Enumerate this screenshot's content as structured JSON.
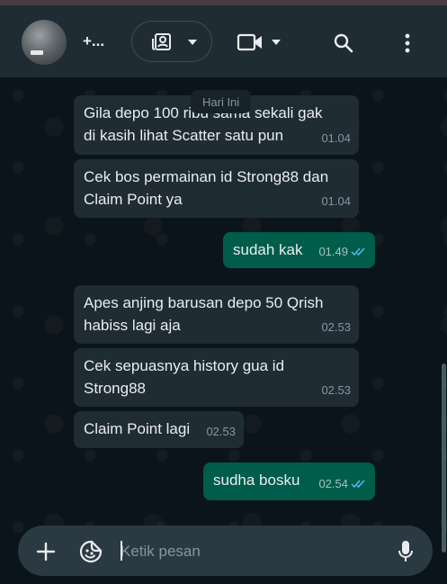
{
  "header": {
    "contact_name": "+...",
    "avatar_label": "",
    "icons": {
      "contacts": "contact-book-icon",
      "dropdown": "chevron-down-icon",
      "video_call": "video-camera-icon",
      "search": "search-icon",
      "menu": "more-vertical-icon"
    }
  },
  "chat": {
    "date_chip": "Hari Ini",
    "messages": [
      {
        "direction": "in",
        "lines": [
          "Gila depo 100 ribu sama sekali  gak",
          "di kasih lihat Scatter satu pun"
        ],
        "time": "01.04"
      },
      {
        "direction": "in",
        "lines": [
          "Cek bos permainan id Strong88 dan",
          "Claim Point ya"
        ],
        "time": "01.04"
      },
      {
        "direction": "out",
        "lines": [
          "sudah kak"
        ],
        "time": "01.49",
        "status": "read"
      },
      {
        "direction": "in",
        "lines": [
          "Apes  anjing barusan depo 50 Qrish",
          "habiss lagi aja"
        ],
        "time": "02.53"
      },
      {
        "direction": "in",
        "lines": [
          "Cek sepuasnya history gua id",
          "Strong88"
        ],
        "time": "02.53"
      },
      {
        "direction": "in",
        "lines": [
          "Claim Point lagi"
        ],
        "time": "02.53"
      },
      {
        "direction": "out",
        "lines": [
          "sudha bosku"
        ],
        "time": "02.54",
        "status": "read"
      }
    ]
  },
  "composer": {
    "placeholder": "Ketik pesan",
    "value": "",
    "icons": {
      "attach": "plus-icon",
      "sticker": "sticker-icon",
      "mic": "microphone-icon"
    }
  },
  "colors": {
    "background": "#0b141a",
    "header": "#202c33",
    "incoming_bubble": "#202c33",
    "outgoing_bubble": "#005c4b",
    "read_ticks": "#53bdeb",
    "secondary_text": "#8696a0"
  }
}
